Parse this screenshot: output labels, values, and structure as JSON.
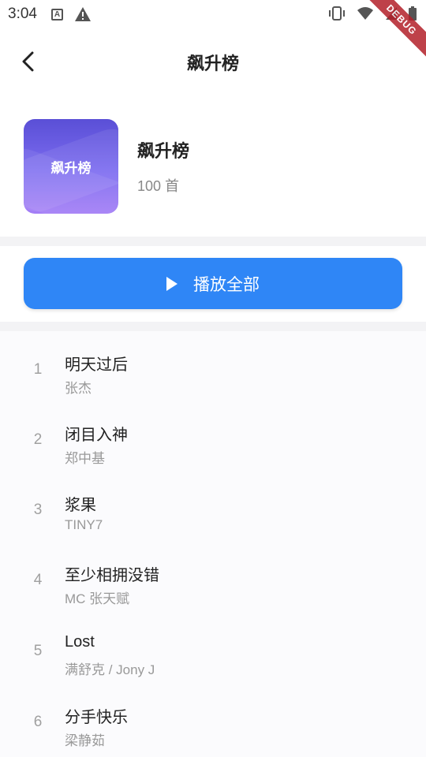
{
  "status_bar": {
    "time": "3:04",
    "icons": [
      "a-notification-icon",
      "warning-icon",
      "vibrate-icon",
      "wifi-icon",
      "signal-icon",
      "battery-icon"
    ]
  },
  "debug_banner": "DEBUG",
  "app_bar": {
    "title": "飙升榜",
    "back_icon": "chevron-left-icon"
  },
  "header": {
    "cover_text": "飙升榜",
    "title": "飙升榜",
    "count": "100 首"
  },
  "play_all": {
    "label": "播放全部",
    "icon": "play-icon"
  },
  "songs": [
    {
      "rank": "1",
      "title": "明天过后",
      "artist": "张杰"
    },
    {
      "rank": "2",
      "title": "闭目入神",
      "artist": "郑中基"
    },
    {
      "rank": "3",
      "title": "浆果",
      "artist": "TINY7"
    },
    {
      "rank": "4",
      "title": "至少相拥没错",
      "artist": "MC 张天赋"
    },
    {
      "rank": "5",
      "title": "Lost",
      "artist": "满舒克 / Jony J"
    },
    {
      "rank": "6",
      "title": "分手快乐",
      "artist": "梁静茹"
    }
  ],
  "colors": {
    "accent": "#2f86f6",
    "cover_gradient_top": "#5a4fd6",
    "cover_gradient_bottom": "#a47ef6",
    "debug_ribbon": "#b3202a"
  }
}
